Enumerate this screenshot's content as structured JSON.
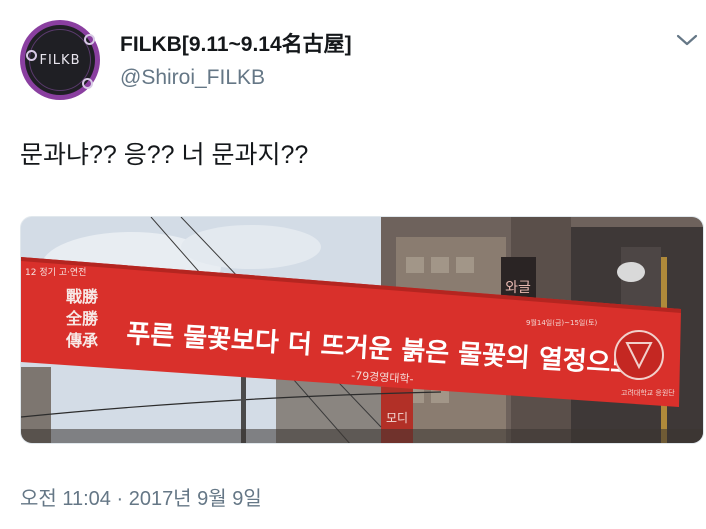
{
  "author": {
    "avatar_text": "FILKB",
    "display_name": "FILKB[9.11~9.14名古屋]",
    "handle": "@Shiroi_FILKB"
  },
  "tweet": {
    "text": "문과냐?? 응?? 너 문과지??",
    "timestamp": "오전 11:04 · 2017년 9월 9일"
  },
  "banner": {
    "top_left": "12 정기 고·연전",
    "side_chars": [
      "戰勝",
      "全勝",
      "傳承"
    ],
    "main_text": "푸른 물꽃보다 더 뜨거운 붉은 물꽃의 열정으로",
    "sub_text": "-79경영대학-",
    "date_text": "9월14일(금)~15일(토)",
    "emblem_caption": "고려대학교 응원단"
  },
  "signs": {
    "vertical_sign": "와글",
    "lower_sign": "모디"
  },
  "colors": {
    "banner_red": "#d9302b",
    "sky": "#c9d4e0",
    "building": "#6e625c",
    "handle_gray": "#657786"
  }
}
